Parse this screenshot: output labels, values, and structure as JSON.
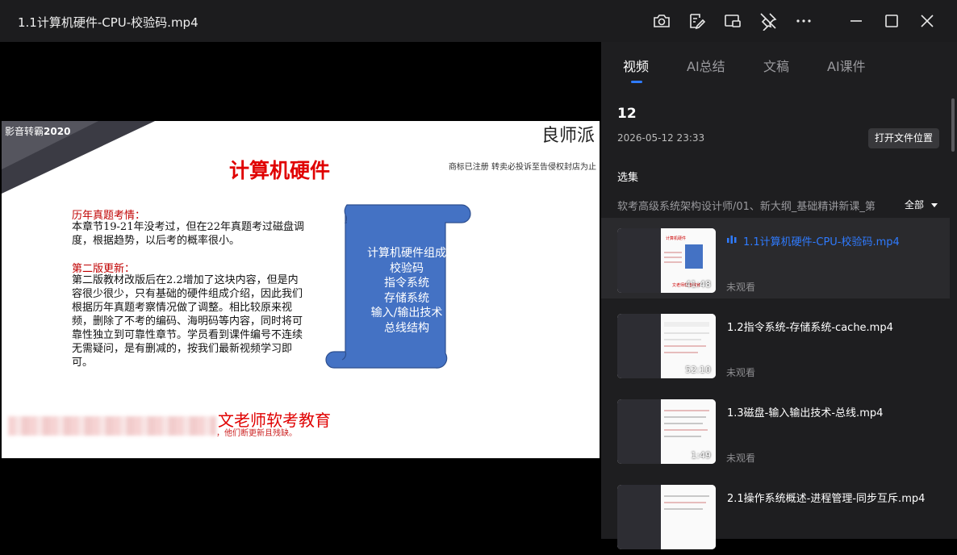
{
  "window": {
    "title": "1.1计算机硬件-CPU-校验码.mp4"
  },
  "slide": {
    "watermark": "影音转霸",
    "watermark_year": "2020",
    "brand": "良师派",
    "trademark": "商标已注册 转卖必投诉至告侵权封店为止",
    "title": "计算机硬件",
    "section1_heading": "历年真题考情：",
    "section1_body": "本章节19-21年没考过，但在22年真题考过磁盘调度，根据趋势，以后考的概率很小。",
    "section2_heading": "第二版更新：",
    "section2_body": "第二版教材改版后在2.2增加了这块内容，但是内容很少很少，只有基础的硬件组成介绍，因此我们根据历年真题考察情况做了调整。相比较原来视频，删除了不考的编码、海明码等内容，同时将可靠性独立到可靠性章节。学员看到课件编号不连续无需疑问，是有删减的，按我们最新视频学习即可。",
    "scroll_items": [
      "计算机硬件组成",
      "校验码",
      "指令系统",
      "存储系统",
      "输入/输出技术",
      "总线结构"
    ],
    "footer_brand": "文老师软考教育",
    "footer_sub": "，他们断更新且残缺。"
  },
  "panel": {
    "tabs": [
      "视频",
      "AI总结",
      "文稿",
      "AI课件"
    ],
    "count": "12",
    "date": "2026-05-12 23:33",
    "open_folder": "打开文件位置",
    "selection_label": "选集",
    "path": "软考高级系统架构设计师/01、新大纲_基础精讲新课_第",
    "filter": "全部",
    "items": [
      {
        "title": "1.1计算机硬件-CPU-校验码.mp4",
        "duration": "41:48",
        "status": "未观看"
      },
      {
        "title": "1.2指令系统-存储系统-cache.mp4",
        "duration": "52:10",
        "status": "未观看"
      },
      {
        "title": "1.3磁盘-输入输出技术-总线.mp4",
        "duration": "1:49",
        "status": "未观看"
      },
      {
        "title": "2.1操作系统概述-进程管理-同步互斥.mp4",
        "duration": "",
        "status": ""
      }
    ]
  },
  "colors": {
    "accent": "#2f7bff",
    "slide_red": "#e00000",
    "scroll_blue": "#4472c4"
  }
}
